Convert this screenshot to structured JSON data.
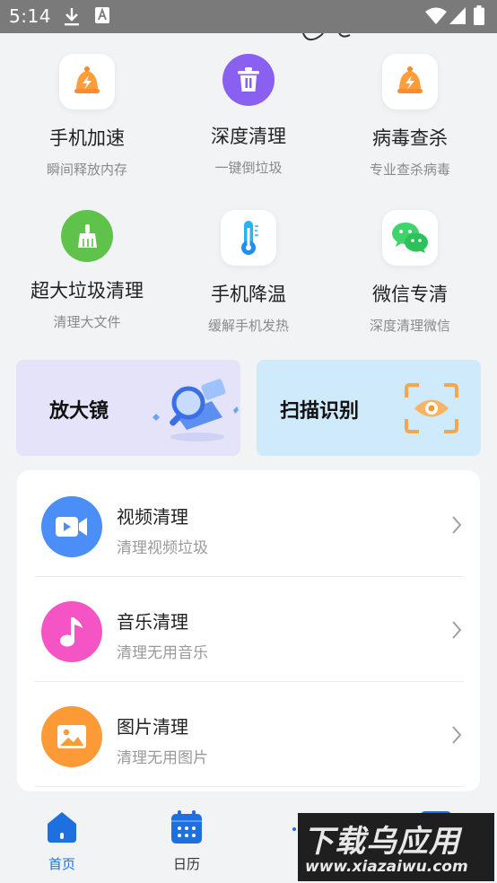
{
  "status_bar": {
    "time": "5:14"
  },
  "tools": [
    {
      "name": "手机加速",
      "sub": "瞬间释放内存",
      "icon": "bell-bolt-icon"
    },
    {
      "name": "深度清理",
      "sub": "一键倒垃圾",
      "icon": "trash-icon"
    },
    {
      "name": "病毒查杀",
      "sub": "专业查杀病毒",
      "icon": "bell-bolt-icon"
    },
    {
      "name": "超大垃圾清理",
      "sub": "清理大文件",
      "icon": "broom-icon"
    },
    {
      "name": "手机降温",
      "sub": "缓解手机发热",
      "icon": "thermometer-icon"
    },
    {
      "name": "微信专清",
      "sub": "深度清理微信",
      "icon": "wechat-icon"
    }
  ],
  "cards": {
    "magnifier": {
      "title": "放大镜",
      "color": "#e4e3fa"
    },
    "scan": {
      "title": "扫描识别",
      "color": "#cfeafb"
    }
  },
  "list": [
    {
      "title": "视频清理",
      "sub": "清理视频垃圾",
      "color": "#4c8ef7",
      "icon": "video-icon"
    },
    {
      "title": "音乐清理",
      "sub": "清理无用音乐",
      "color": "#f454c4",
      "icon": "music-note-icon"
    },
    {
      "title": "图片清理",
      "sub": "清理无用图片",
      "color": "#fb9a37",
      "icon": "image-icon"
    }
  ],
  "nav": [
    {
      "label": "首页",
      "icon": "home-icon",
      "active": true
    },
    {
      "label": "日历",
      "icon": "calendar-icon",
      "active": false
    }
  ],
  "watermark": {
    "big": "下载乌应用",
    "small": "www.xiazaiwu.com"
  },
  "colors": {
    "accent": "#1e6fe0",
    "background": "#f2f3f5"
  }
}
